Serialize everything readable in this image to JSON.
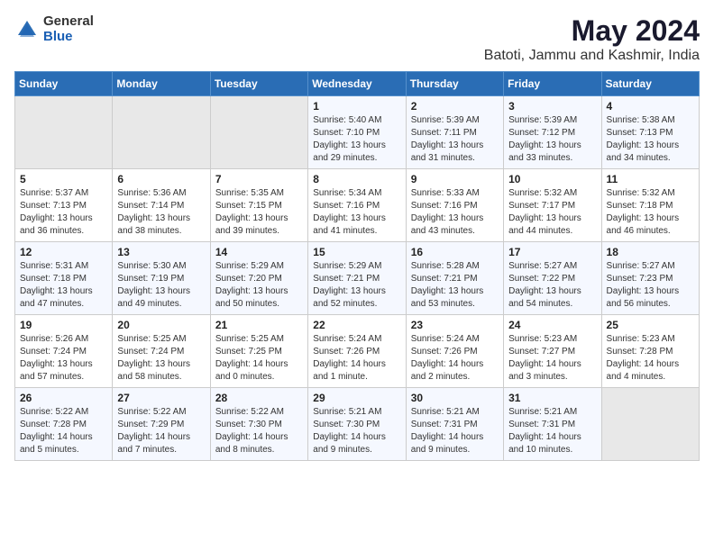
{
  "logo": {
    "general": "General",
    "blue": "Blue"
  },
  "title": "May 2024",
  "subtitle": "Batoti, Jammu and Kashmir, India",
  "headers": [
    "Sunday",
    "Monday",
    "Tuesday",
    "Wednesday",
    "Thursday",
    "Friday",
    "Saturday"
  ],
  "weeks": [
    [
      {
        "day": "",
        "info": ""
      },
      {
        "day": "",
        "info": ""
      },
      {
        "day": "",
        "info": ""
      },
      {
        "day": "1",
        "info": "Sunrise: 5:40 AM\nSunset: 7:10 PM\nDaylight: 13 hours\nand 29 minutes."
      },
      {
        "day": "2",
        "info": "Sunrise: 5:39 AM\nSunset: 7:11 PM\nDaylight: 13 hours\nand 31 minutes."
      },
      {
        "day": "3",
        "info": "Sunrise: 5:39 AM\nSunset: 7:12 PM\nDaylight: 13 hours\nand 33 minutes."
      },
      {
        "day": "4",
        "info": "Sunrise: 5:38 AM\nSunset: 7:13 PM\nDaylight: 13 hours\nand 34 minutes."
      }
    ],
    [
      {
        "day": "5",
        "info": "Sunrise: 5:37 AM\nSunset: 7:13 PM\nDaylight: 13 hours\nand 36 minutes."
      },
      {
        "day": "6",
        "info": "Sunrise: 5:36 AM\nSunset: 7:14 PM\nDaylight: 13 hours\nand 38 minutes."
      },
      {
        "day": "7",
        "info": "Sunrise: 5:35 AM\nSunset: 7:15 PM\nDaylight: 13 hours\nand 39 minutes."
      },
      {
        "day": "8",
        "info": "Sunrise: 5:34 AM\nSunset: 7:16 PM\nDaylight: 13 hours\nand 41 minutes."
      },
      {
        "day": "9",
        "info": "Sunrise: 5:33 AM\nSunset: 7:16 PM\nDaylight: 13 hours\nand 43 minutes."
      },
      {
        "day": "10",
        "info": "Sunrise: 5:32 AM\nSunset: 7:17 PM\nDaylight: 13 hours\nand 44 minutes."
      },
      {
        "day": "11",
        "info": "Sunrise: 5:32 AM\nSunset: 7:18 PM\nDaylight: 13 hours\nand 46 minutes."
      }
    ],
    [
      {
        "day": "12",
        "info": "Sunrise: 5:31 AM\nSunset: 7:18 PM\nDaylight: 13 hours\nand 47 minutes."
      },
      {
        "day": "13",
        "info": "Sunrise: 5:30 AM\nSunset: 7:19 PM\nDaylight: 13 hours\nand 49 minutes."
      },
      {
        "day": "14",
        "info": "Sunrise: 5:29 AM\nSunset: 7:20 PM\nDaylight: 13 hours\nand 50 minutes."
      },
      {
        "day": "15",
        "info": "Sunrise: 5:29 AM\nSunset: 7:21 PM\nDaylight: 13 hours\nand 52 minutes."
      },
      {
        "day": "16",
        "info": "Sunrise: 5:28 AM\nSunset: 7:21 PM\nDaylight: 13 hours\nand 53 minutes."
      },
      {
        "day": "17",
        "info": "Sunrise: 5:27 AM\nSunset: 7:22 PM\nDaylight: 13 hours\nand 54 minutes."
      },
      {
        "day": "18",
        "info": "Sunrise: 5:27 AM\nSunset: 7:23 PM\nDaylight: 13 hours\nand 56 minutes."
      }
    ],
    [
      {
        "day": "19",
        "info": "Sunrise: 5:26 AM\nSunset: 7:24 PM\nDaylight: 13 hours\nand 57 minutes."
      },
      {
        "day": "20",
        "info": "Sunrise: 5:25 AM\nSunset: 7:24 PM\nDaylight: 13 hours\nand 58 minutes."
      },
      {
        "day": "21",
        "info": "Sunrise: 5:25 AM\nSunset: 7:25 PM\nDaylight: 14 hours\nand 0 minutes."
      },
      {
        "day": "22",
        "info": "Sunrise: 5:24 AM\nSunset: 7:26 PM\nDaylight: 14 hours\nand 1 minute."
      },
      {
        "day": "23",
        "info": "Sunrise: 5:24 AM\nSunset: 7:26 PM\nDaylight: 14 hours\nand 2 minutes."
      },
      {
        "day": "24",
        "info": "Sunrise: 5:23 AM\nSunset: 7:27 PM\nDaylight: 14 hours\nand 3 minutes."
      },
      {
        "day": "25",
        "info": "Sunrise: 5:23 AM\nSunset: 7:28 PM\nDaylight: 14 hours\nand 4 minutes."
      }
    ],
    [
      {
        "day": "26",
        "info": "Sunrise: 5:22 AM\nSunset: 7:28 PM\nDaylight: 14 hours\nand 5 minutes."
      },
      {
        "day": "27",
        "info": "Sunrise: 5:22 AM\nSunset: 7:29 PM\nDaylight: 14 hours\nand 7 minutes."
      },
      {
        "day": "28",
        "info": "Sunrise: 5:22 AM\nSunset: 7:30 PM\nDaylight: 14 hours\nand 8 minutes."
      },
      {
        "day": "29",
        "info": "Sunrise: 5:21 AM\nSunset: 7:30 PM\nDaylight: 14 hours\nand 9 minutes."
      },
      {
        "day": "30",
        "info": "Sunrise: 5:21 AM\nSunset: 7:31 PM\nDaylight: 14 hours\nand 9 minutes."
      },
      {
        "day": "31",
        "info": "Sunrise: 5:21 AM\nSunset: 7:31 PM\nDaylight: 14 hours\nand 10 minutes."
      },
      {
        "day": "",
        "info": ""
      }
    ]
  ]
}
